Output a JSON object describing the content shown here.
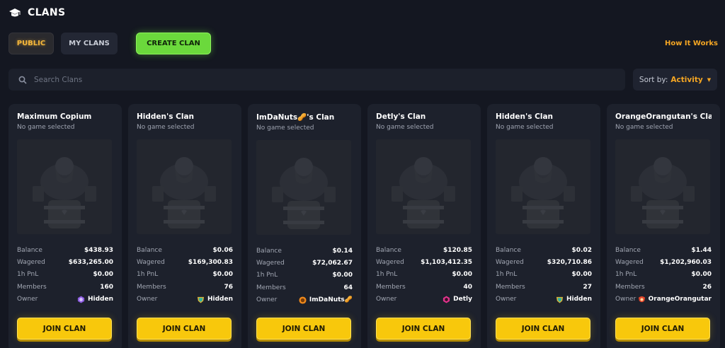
{
  "header": {
    "title": "CLANS",
    "icon": "graduation-cap-icon"
  },
  "tabs": {
    "public": "PUBLIC",
    "my_clans": "MY CLANS",
    "create": "CREATE CLAN"
  },
  "how_it_works": "How It Works",
  "search": {
    "placeholder": "Search Clans",
    "value": ""
  },
  "sort": {
    "label": "Sort by:",
    "value": "Activity"
  },
  "labels": {
    "balance": "Balance",
    "wagered": "Wagered",
    "pnl": "1h PnL",
    "members": "Members",
    "owner": "Owner",
    "join": "JOIN CLAN"
  },
  "colors": {
    "accent": "#f5a623",
    "create_green": "#6bd93c",
    "join_yellow": "#f8c80c",
    "background": "#141721",
    "card": "#1d212c"
  },
  "cards": [
    {
      "name": "Maximum Copium",
      "status": "No game selected",
      "balance": "$438.93",
      "wagered": "$633,265.00",
      "pnl": "$0.00",
      "members": "160",
      "owner": "Hidden",
      "owner_badge": "purple-badge-icon"
    },
    {
      "name": "Hidden's Clan",
      "status": "No game selected",
      "balance": "$0.06",
      "wagered": "$169,300.83",
      "pnl": "$0.00",
      "members": "76",
      "owner": "Hidden",
      "owner_badge": "teal-gold-badge-icon"
    },
    {
      "name": "ImDaNuts🥜's Clan",
      "status": "No game selected",
      "balance": "$0.14",
      "wagered": "$72,062.67",
      "pnl": "$0.00",
      "members": "64",
      "owner": "ImDaNuts🥜",
      "owner_badge": "orange-badge-icon"
    },
    {
      "name": "Detly's Clan",
      "status": "No game selected",
      "balance": "$120.85",
      "wagered": "$1,103,412.35",
      "pnl": "$0.00",
      "members": "40",
      "owner": "Detly",
      "owner_badge": "pink-gem-icon"
    },
    {
      "name": "Hidden's Clan",
      "status": "No game selected",
      "balance": "$0.02",
      "wagered": "$320,710.86",
      "pnl": "$0.00",
      "members": "27",
      "owner": "Hidden",
      "owner_badge": "teal-gold-badge-icon"
    },
    {
      "name": "OrangeOrangutan's Clan",
      "status": "No game selected",
      "balance": "$1.44",
      "wagered": "$1,202,960.03",
      "pnl": "$0.00",
      "members": "26",
      "owner": "OrangeOrangutar",
      "owner_badge": "red-orange-badge-icon"
    }
  ]
}
